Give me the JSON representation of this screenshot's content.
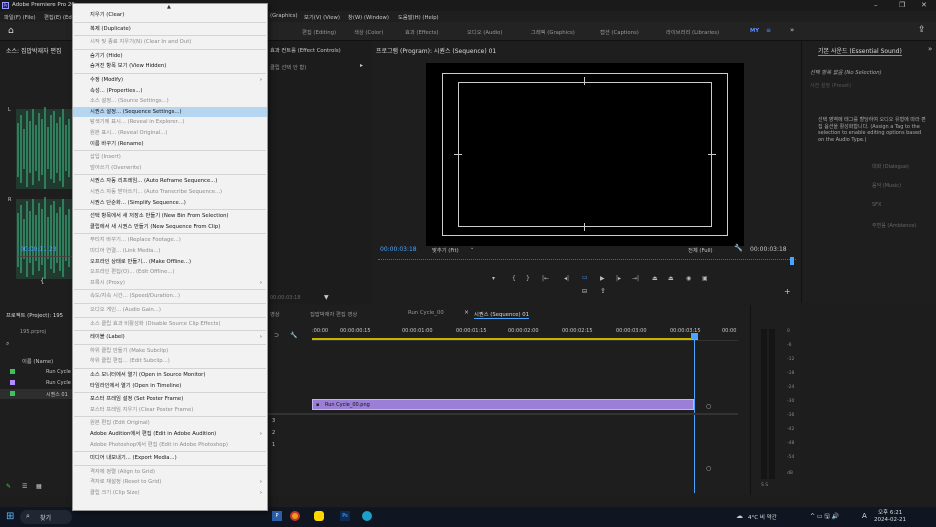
{
  "titlebar": {
    "title": "Adobe Premiere Pro 20",
    "minimize": "–",
    "maximize": "❐",
    "close": "✕"
  },
  "menubar": {
    "items": [
      "파일(F) (File)",
      "편집(E) (Ed",
      "(Graphics)",
      "보기(V) (View)",
      "창(W) (Window)",
      "도움말(H) (Help)"
    ]
  },
  "workspaces": {
    "tabs": [
      "편집 (Editing)",
      "색상 (Color)",
      "효과 (Effects)",
      "오디오 (Audio)",
      "그래픽 (Graphics)",
      "캡션 (Captions)",
      "라이브러리 (Libraries)",
      "MY"
    ],
    "more": "»"
  },
  "source": {
    "title": "소스: 집밥박재자 편집",
    "timecode": "00:00:11:23"
  },
  "effect_controls": {
    "title": "효과 컨트롤 (Effect Controls)",
    "subtitle": "클립 선택 안 함)",
    "timecode": "00:00:03:18"
  },
  "program": {
    "title": "프로그램 (Program): 시퀀스 (Sequence) 01",
    "timecode": "00:00:03:18",
    "fit": "맞추기 (Fit)",
    "full": "전체 (Full)",
    "duration": "00:00:03:18"
  },
  "essential": {
    "title": "기본 사운드 (Essential Sound)",
    "no_selection": "선택 항목 없음 (No Selection)",
    "preset": "사전 설정 (Preset)",
    "message": "선택 영역에 태그를 할당하여 오디오 유형에 따라 편집 옵션을 활성화합니다. (Assign a Tag to the selection to enable editing options based on the Audio Type.)",
    "buttons": [
      "대화 (Dialogue)",
      "음악 (Music)",
      "SFX",
      "주변음 (Ambience)"
    ]
  },
  "project": {
    "title": "프로젝트 (Project): 195",
    "count": "195.prproj",
    "col_name": "이름 (Name)",
    "items": [
      "Run Cycle",
      "Run Cycle",
      "시퀀스 01"
    ]
  },
  "timeline": {
    "tabs": [
      "영상",
      "집밥박재자 편집 영상",
      "Run Cycle_00",
      "시퀀스 (Sequence) 01"
    ],
    "ruler": [
      ":00:00",
      "00:00:00:15",
      "00:00:01:00",
      "00:00:01:15",
      "00:00:02:00",
      "00:00:02:15",
      "00:00:03:00",
      "00:00:03:15",
      "00:00"
    ],
    "clip": "Run Cycle_00.png"
  },
  "meter": {
    "labels": [
      "0",
      "-6",
      "-12",
      "-18",
      "-24",
      "-30",
      "-36",
      "-42",
      "-48",
      "-54",
      "dB"
    ],
    "solo": "S  S"
  },
  "context_menu": [
    {
      "label": "지우기 (Clear)"
    },
    {
      "sep": true
    },
    {
      "label": "복제 (Duplicate)"
    },
    {
      "sep": true
    },
    {
      "label": "시작 및 종료 지우기(N) (Clear In and Out)",
      "disabled": true
    },
    {
      "sep": true
    },
    {
      "label": "숨기기 (Hide)"
    },
    {
      "label": "숨겨진 항목 보기 (View Hidden)"
    },
    {
      "sep": true
    },
    {
      "label": "수정 (Modify)",
      "sub": true
    },
    {
      "label": "속성... (Properties...)"
    },
    {
      "label": "소스 설정... (Source Settings...)",
      "disabled": true
    },
    {
      "label": "시퀀스 설정... (Sequence Settings...)",
      "highlight": true
    },
    {
      "label": "탐색기에 표시... (Reveal in Explorer...)",
      "disabled": true
    },
    {
      "label": "원본 표시... (Reveal Original...)",
      "disabled": true
    },
    {
      "label": "이름 바꾸기 (Rename)"
    },
    {
      "sep": true
    },
    {
      "label": "삽입 (Insert)",
      "disabled": true
    },
    {
      "label": "덮어쓰기 (Overwrite)",
      "disabled": true
    },
    {
      "sep": true
    },
    {
      "label": "시퀀스 자동 리프레임... (Auto Reframe Sequence...)"
    },
    {
      "label": "시퀀스 자동 받아쓰기... (Auto Transcribe Sequence...)",
      "disabled": true
    },
    {
      "label": "시퀀스 단순화... (Simplify Sequence...)"
    },
    {
      "sep": true
    },
    {
      "label": "선택 항목에서 새 저장소 만들기 (New Bin From Selection)"
    },
    {
      "label": "클립에서 새 시퀀스 만들기 (New Sequence From Clip)"
    },
    {
      "sep": true
    },
    {
      "label": "푸티지 바꾸기... (Replace Footage...)",
      "disabled": true
    },
    {
      "label": "미디어 연결... (Link Media...)",
      "disabled": true
    },
    {
      "label": "오프라인 상태로 만들기... (Make Offline...)"
    },
    {
      "label": "오프라인 편집(O)... (Edit Offline...)",
      "disabled": true
    },
    {
      "label": "프록시 (Proxy)",
      "disabled": true,
      "sub": true
    },
    {
      "sep": true
    },
    {
      "label": "속도/지속 시간... (Speed/Duration...)",
      "disabled": true
    },
    {
      "sep": true
    },
    {
      "label": "오디오 게인... (Audio Gain...)",
      "disabled": true
    },
    {
      "sep": true
    },
    {
      "label": "소스 클립 효과 비활성화 (Disable Source Clip Effects)",
      "disabled": true
    },
    {
      "sep": true
    },
    {
      "label": "레이블 (Label)",
      "sub": true
    },
    {
      "sep": true
    },
    {
      "label": "하위 클립 만들기 (Make Subclip)",
      "disabled": true
    },
    {
      "label": "하위 클립 편집... (Edit Subclip...)",
      "disabled": true
    },
    {
      "sep": true
    },
    {
      "label": "소스 모니터에서 열기 (Open in Source Monitor)"
    },
    {
      "label": "타임라인에서 열기 (Open in Timeline)"
    },
    {
      "sep": true
    },
    {
      "label": "포스터 프레임 설정 (Set Poster Frame)"
    },
    {
      "label": "포스터 프레임 지우기 (Clear Poster Frame)",
      "disabled": true
    },
    {
      "sep": true
    },
    {
      "label": "원본 편집 (Edit Original)",
      "disabled": true
    },
    {
      "label": "Adobe Audition에서 편집 (Edit in Adobe Audition)",
      "sub": true
    },
    {
      "label": "Adobe Photoshop에서 편집 (Edit in Adobe Photoshop)",
      "disabled": true
    },
    {
      "sep": true
    },
    {
      "label": "미디어 내보내기... (Export Media...)"
    },
    {
      "sep": true
    },
    {
      "label": "격자에 정렬 (Align to Grid)",
      "disabled": true
    },
    {
      "label": "격자로 재설정 (Reset to Grid)",
      "disabled": true,
      "sub": true
    },
    {
      "label": "클립 크기 (Clip Size)",
      "disabled": true,
      "sub": true
    }
  ],
  "taskbar": {
    "search": "찾기",
    "weather": "4°C 비 약간",
    "ime": "A",
    "time": "오후 6:21",
    "date": "2024-02-21"
  }
}
